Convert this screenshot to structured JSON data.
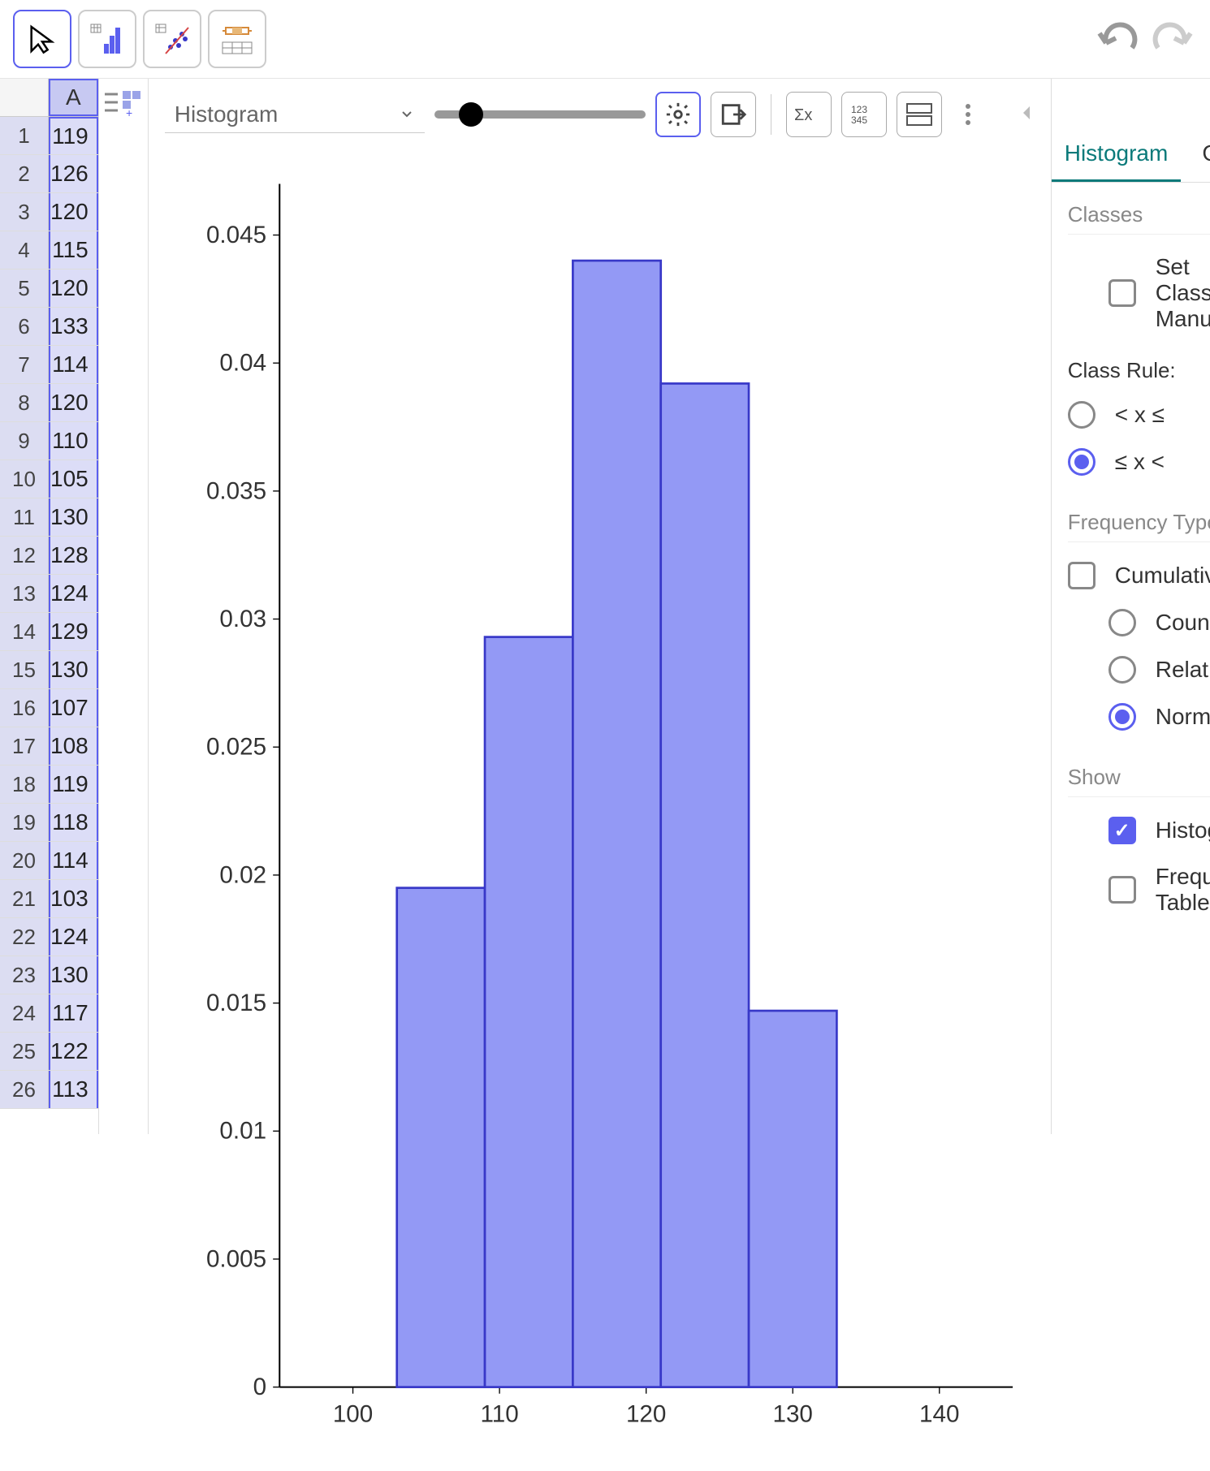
{
  "spreadsheet": {
    "column_header": "A",
    "rows": [
      {
        "n": 1,
        "v": 119
      },
      {
        "n": 2,
        "v": 126
      },
      {
        "n": 3,
        "v": 120
      },
      {
        "n": 4,
        "v": 115
      },
      {
        "n": 5,
        "v": 120
      },
      {
        "n": 6,
        "v": 133
      },
      {
        "n": 7,
        "v": 114
      },
      {
        "n": 8,
        "v": 120
      },
      {
        "n": 9,
        "v": 110
      },
      {
        "n": 10,
        "v": 105
      },
      {
        "n": 11,
        "v": 130
      },
      {
        "n": 12,
        "v": 128
      },
      {
        "n": 13,
        "v": 124
      },
      {
        "n": 14,
        "v": 129
      },
      {
        "n": 15,
        "v": 130
      },
      {
        "n": 16,
        "v": 107
      },
      {
        "n": 17,
        "v": 108
      },
      {
        "n": 18,
        "v": 119
      },
      {
        "n": 19,
        "v": 118
      },
      {
        "n": 20,
        "v": 114
      },
      {
        "n": 21,
        "v": 103
      },
      {
        "n": 22,
        "v": 124
      },
      {
        "n": 23,
        "v": 130
      },
      {
        "n": 24,
        "v": 117
      },
      {
        "n": 25,
        "v": 122
      },
      {
        "n": 26,
        "v": 113
      }
    ]
  },
  "dropdown_label": "Histogram",
  "tabs": {
    "histogram": "Histogram",
    "graph": "Graph"
  },
  "panel": {
    "classes_title": "Classes",
    "set_manually": "Set Classes Manually",
    "class_rule_label": "Class Rule:",
    "rule1": "< x ≤",
    "rule2": "≤ x <",
    "freq_type_title": "Frequency Type",
    "cumulative": "Cumulative",
    "count": "Count",
    "relative": "Relative",
    "normalized": "Normalized",
    "show_title": "Show",
    "show_histogram": "Histogram",
    "show_freq_table": "Frequency Table"
  },
  "chart_data": {
    "type": "bar",
    "title": "",
    "xlabel": "",
    "ylabel": "",
    "x_ticks": [
      100,
      110,
      120,
      130,
      140
    ],
    "y_ticks": [
      0,
      0.005,
      0.01,
      0.015,
      0.02,
      0.025,
      0.03,
      0.035,
      0.04,
      0.045
    ],
    "xlim": [
      95,
      145
    ],
    "ylim": [
      0,
      0.047
    ],
    "bin_width": 6,
    "bins": [
      {
        "start": 103,
        "end": 109,
        "value": 0.0195
      },
      {
        "start": 109,
        "end": 115,
        "value": 0.0293
      },
      {
        "start": 115,
        "end": 121,
        "value": 0.044
      },
      {
        "start": 121,
        "end": 127,
        "value": 0.0392
      },
      {
        "start": 127,
        "end": 133,
        "value": 0.0147
      }
    ]
  }
}
